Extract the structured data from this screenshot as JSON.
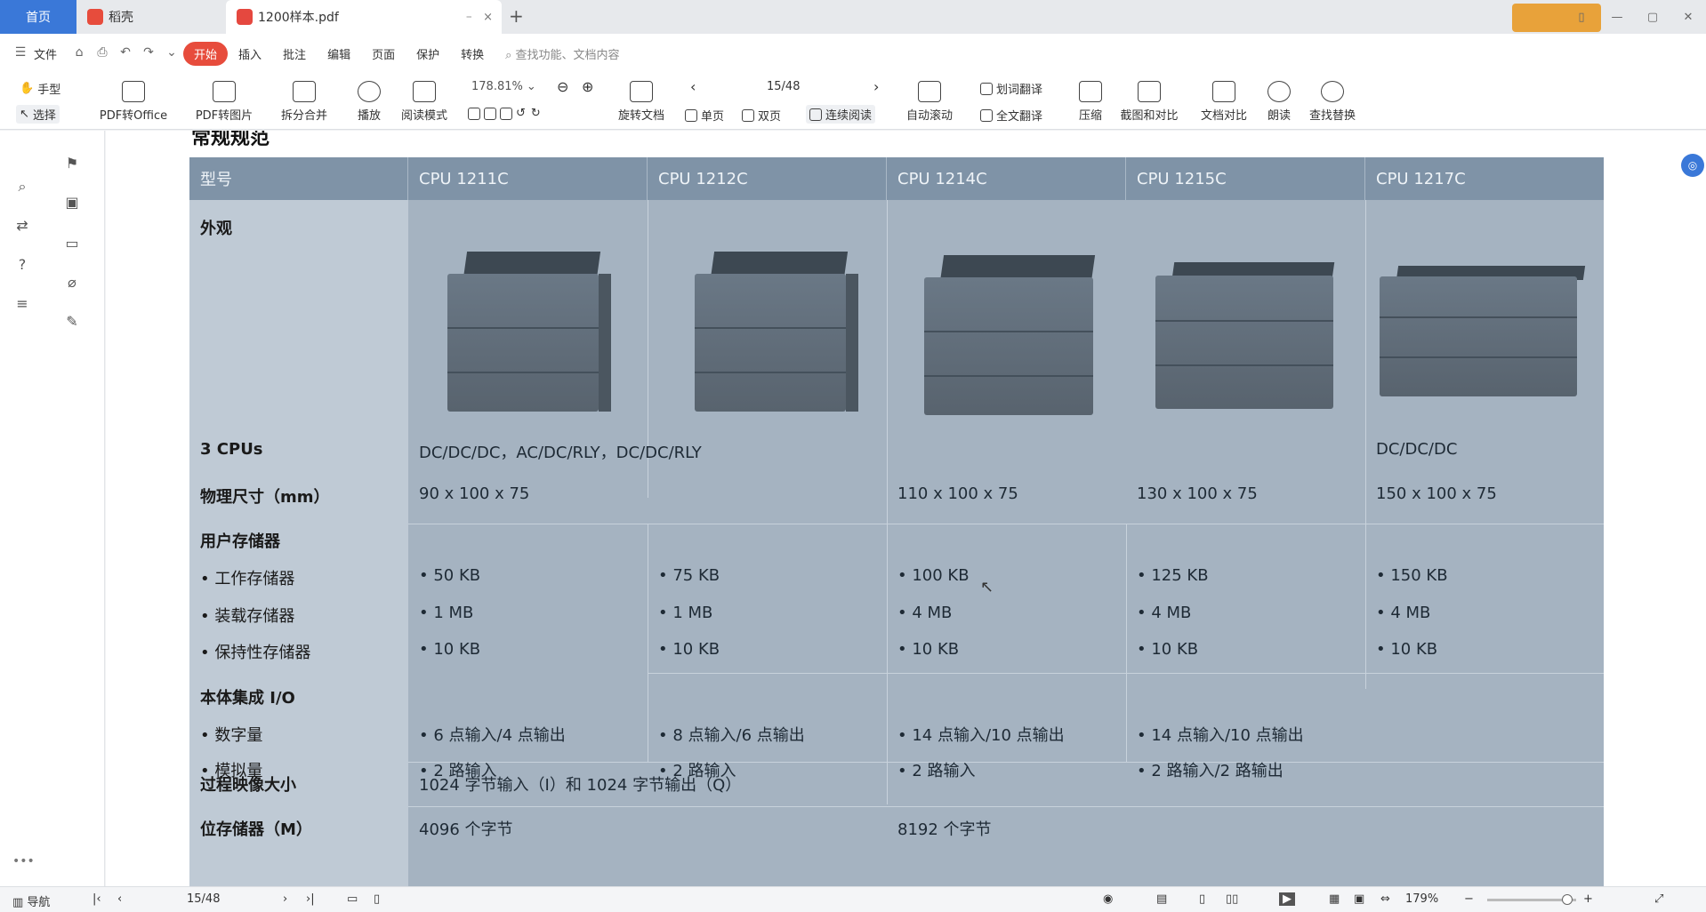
{
  "tabs": {
    "home": "首页",
    "tab1": "稻壳",
    "tab2": "1200样本.pdf",
    "close": "×",
    "pin": "⎯",
    "new": "+"
  },
  "menu": {
    "file": "文件",
    "items": [
      "开始",
      "插入",
      "批注",
      "编辑",
      "页面",
      "保护",
      "转换"
    ],
    "search_placeholder": "查找功能、文档内容"
  },
  "toolbar": {
    "hand": "手型",
    "select": "选择",
    "pdf_to_office": "PDF转Office",
    "pdf_to_image": "PDF转图片",
    "split_merge": "拆分合并",
    "play": "播放",
    "read_mode": "阅读模式",
    "zoom": "178.81%",
    "rotate": "旋转文档",
    "single_page": "单页",
    "double_page": "双页",
    "continuous": "连续阅读",
    "page_indicator": "15/48",
    "auto_scroll": "自动滚动",
    "translate_word": "划词翻译",
    "translate_full": "全文翻译",
    "compress": "压缩",
    "screenshot_compare": "截图和对比",
    "doc_compare": "文档对比",
    "read_aloud": "朗读",
    "find_replace": "查找替换"
  },
  "sidebar": {
    "more": "•••"
  },
  "document": {
    "section_title": "常规规范",
    "header": [
      "型号",
      "CPU 1211C",
      "CPU 1212C",
      "CPU 1214C",
      "CPU 1215C",
      "CPU 1217C"
    ],
    "rows": {
      "appearance": "外观",
      "cpus_label": "3 CPUs",
      "cpus_value_a": "DC/DC/DC，AC/DC/RLY，DC/DC/RLY",
      "cpus_value_b": "DC/DC/DC",
      "size_label": "物理尺寸（mm）",
      "size_values": [
        "90 x 100 x 75",
        "110 x 100 x 75",
        "130 x 100 x 75",
        "150 x 100 x 75"
      ],
      "memory_label": "用户存储器",
      "work_mem_label": "• 工作存储器",
      "load_mem_label": "• 装载存储器",
      "retain_mem_label": "• 保持性存储器",
      "work_mem": [
        "• 50 KB",
        "• 75 KB",
        "• 100 KB",
        "• 125 KB",
        "• 150 KB"
      ],
      "load_mem": [
        "• 1 MB",
        "• 1 MB",
        "• 4 MB",
        "• 4 MB",
        "• 4 MB"
      ],
      "retain_mem": [
        "• 10 KB",
        "• 10 KB",
        "• 10 KB",
        "• 10 KB",
        "• 10 KB"
      ],
      "io_label": "本体集成 I/O",
      "digital_label": "• 数字量",
      "analog_label": "• 模拟量",
      "digital": [
        "• 6 点输入/4 点输出",
        "• 8 点输入/6 点输出",
        "• 14 点输入/10 点输出",
        "• 14 点输入/10 点输出"
      ],
      "analog": [
        "• 2 路输入",
        "• 2 路输入",
        "• 2 路输入",
        "• 2 路输入/2 路输出"
      ],
      "process_label": "过程映像大小",
      "process_value": "1024 字节输入（I）和 1024 字节输出（Q）",
      "bitmem_label": "位存储器（M）",
      "bitmem_values": [
        "4096 个字节",
        "8192 个字节"
      ]
    }
  },
  "status": {
    "nav": "导航",
    "page": "15/48",
    "zoom": "179%"
  },
  "colors": {
    "accent": "#e74c3c",
    "blue": "#3a78d8",
    "table_header": "#7f93a7",
    "table_body": "#a5b3c1"
  }
}
